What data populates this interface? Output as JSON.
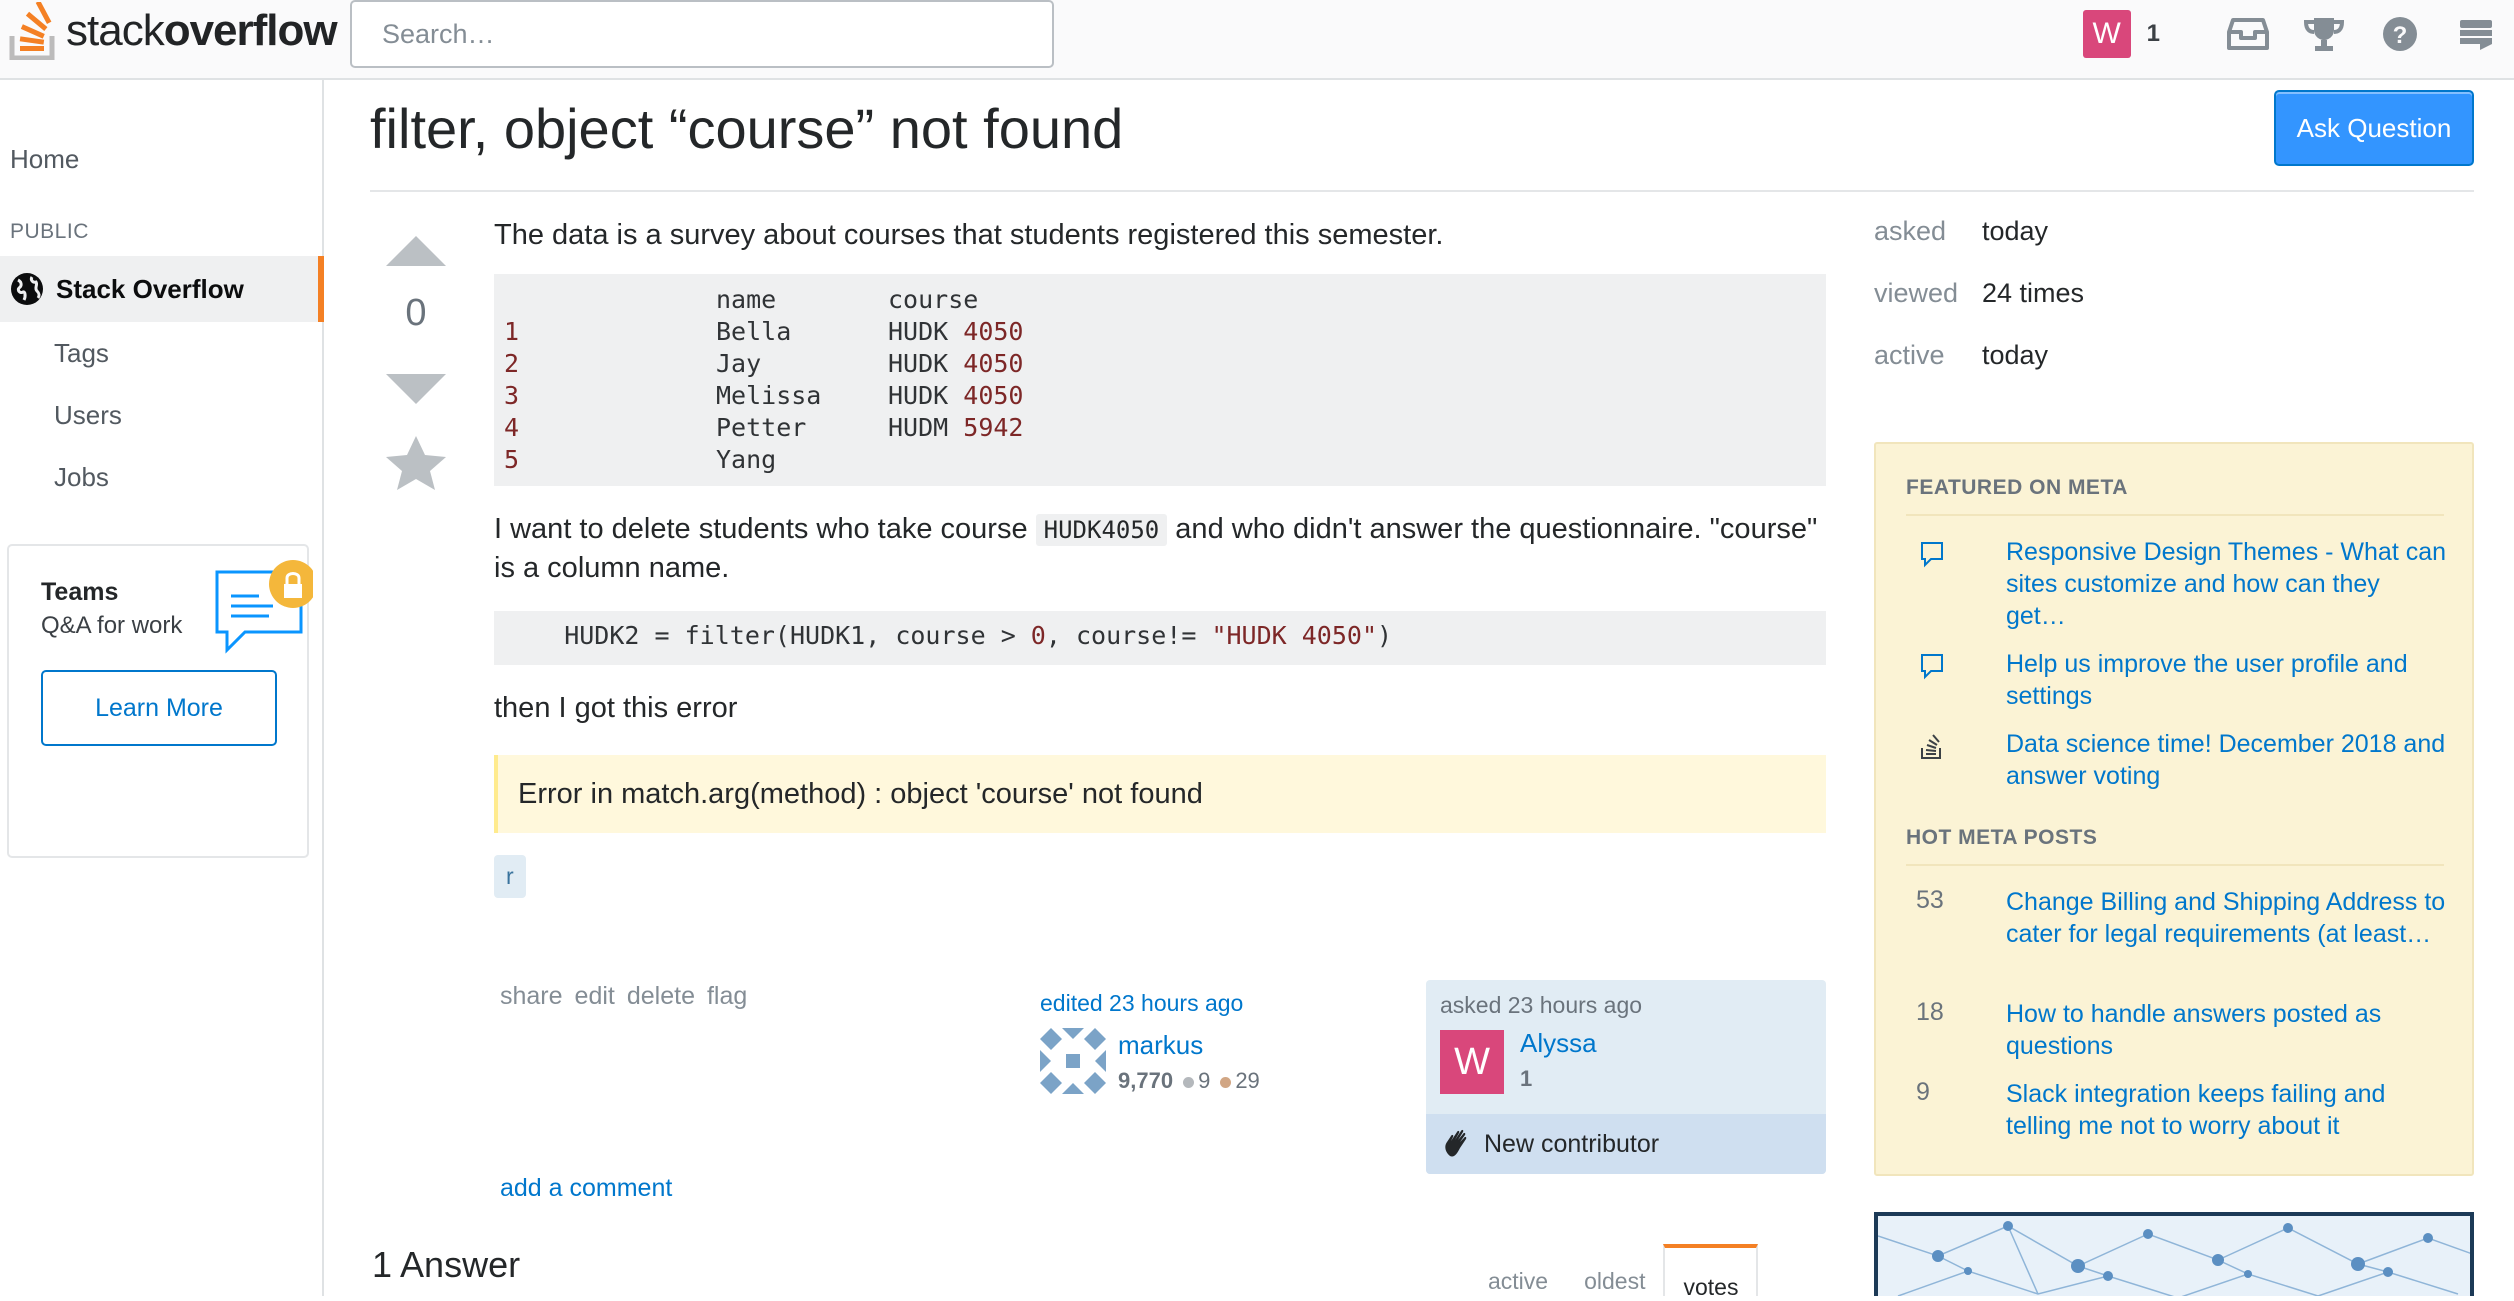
{
  "topbar": {
    "logo_light": "stack",
    "logo_bold": "overflow",
    "search_placeholder": "Search…",
    "user_avatar_letter": "W",
    "reputation": "1",
    "icons": [
      "inbox-icon",
      "trophy-icon",
      "help-icon",
      "site-switcher-icon"
    ]
  },
  "leftnav": {
    "home": "Home",
    "public_label": "PUBLIC",
    "stack_overflow": "Stack Overflow",
    "tags": "Tags",
    "users": "Users",
    "jobs": "Jobs",
    "teams": {
      "title": "Teams",
      "subtitle": "Q&A for work",
      "button": "Learn More"
    }
  },
  "question": {
    "title": "filter, object “course” not found",
    "ask_button": "Ask Question",
    "vote_count": "0",
    "intro": "The data is a survey about courses that students registered this semester.",
    "table_header": {
      "name": "name",
      "course": "course"
    },
    "table_rows": [
      {
        "idx": "1",
        "name": "Bella",
        "course_code": "HUDK",
        "course_num": "4050"
      },
      {
        "idx": "2",
        "name": "Jay",
        "course_code": "HUDK",
        "course_num": "4050"
      },
      {
        "idx": "3",
        "name": "Melissa",
        "course_code": "HUDK",
        "course_num": "4050"
      },
      {
        "idx": "4",
        "name": "Petter",
        "course_code": "HUDM",
        "course_num": "5942"
      },
      {
        "idx": "5",
        "name": "Yang",
        "course_code": "",
        "course_num": ""
      }
    ],
    "para2_before": "I want to delete students who take course ",
    "para2_code": "HUDK4050",
    "para2_after": " and who didn't answer the questionnaire. \"course\" is a column name.",
    "code_line_a": "    HUDK2 = filter(HUDK1, course > ",
    "code_line_num": "0",
    "code_line_b": ", course!= ",
    "code_line_str": "\"HUDK 4050\"",
    "code_line_c": ")",
    "para3": "then I got this error",
    "error": "Error in match.arg(method) : object 'course' not found",
    "tag": "r",
    "menu": [
      "share",
      "edit",
      "delete",
      "flag"
    ],
    "edited": {
      "label": "edited 23 hours ago",
      "user": "markus",
      "rep": "9,770",
      "silver": "9",
      "bronze": "29"
    },
    "asked": {
      "label": "asked 23 hours ago",
      "avatar_letter": "W",
      "user": "Alyssa",
      "rep": "1",
      "new_contributor": "New contributor"
    },
    "add_comment": "add a comment",
    "answers_heading": "1 Answer",
    "sort_tabs": [
      "active",
      "oldest",
      "votes"
    ]
  },
  "stats": {
    "asked_label": "asked",
    "asked_val": "today",
    "viewed_label": "viewed",
    "viewed_val": "24 times",
    "active_label": "active",
    "active_val": "today"
  },
  "meta": {
    "featured_heading": "FEATURED ON META",
    "featured": [
      {
        "icon": "meta-speech-icon",
        "text": "Responsive Design Themes - What can sites customize and how can they get…"
      },
      {
        "icon": "meta-speech-icon",
        "text": "Help us improve the user profile and settings"
      },
      {
        "icon": "stack-overflow-icon",
        "text": "Data science time! December 2018 and answer voting"
      }
    ],
    "hot_heading": "HOT META POSTS",
    "hot": [
      {
        "count": "53",
        "text": "Change Billing and Shipping Address to cater for legal requirements (at least…"
      },
      {
        "count": "18",
        "text": "How to handle answers posted as questions"
      },
      {
        "count": "9",
        "text": "Slack integration keeps failing and telling me not to worry about it"
      }
    ]
  },
  "colors": {
    "accent_orange": "#f48024",
    "link_blue": "#0077cc",
    "button_blue": "#3395ff",
    "avatar_pink": "#d9477b",
    "meta_bg": "#fbf3d5"
  }
}
